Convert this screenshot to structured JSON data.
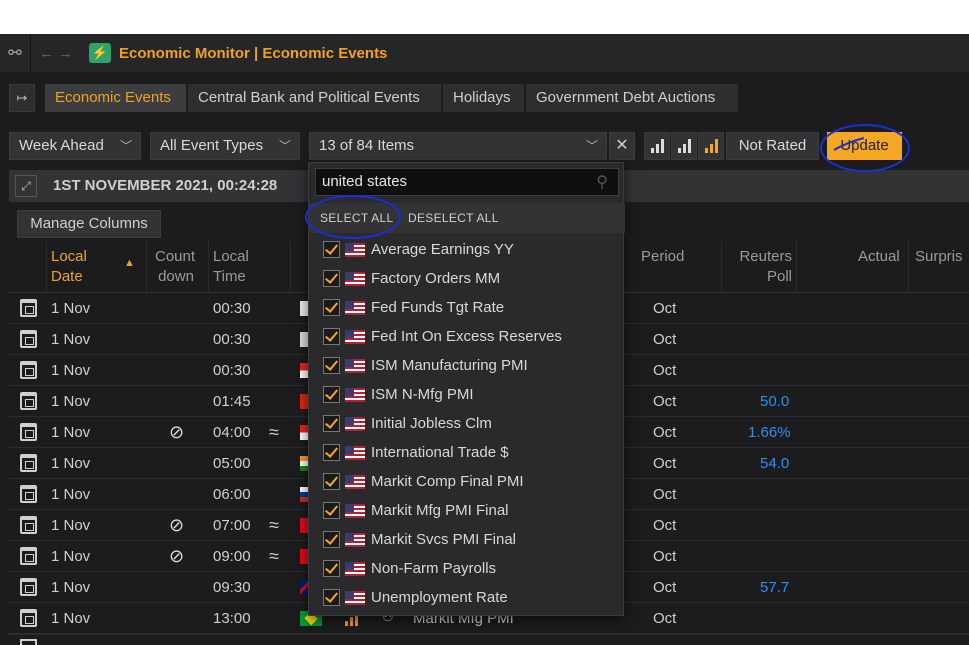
{
  "app": {
    "title": "Economic Monitor | Economic Events"
  },
  "tabs": [
    "Economic Events",
    "Central Bank and Political Events",
    "Holidays",
    "Government Debt Auctions"
  ],
  "filters": {
    "period": "Week Ahead",
    "event_types": "All Event Types",
    "items": "13 of 84 Items",
    "not_rated": "Not Rated",
    "update": "Update"
  },
  "date_header": "1ST NOVEMBER 2021, 00:24:28",
  "manage_columns": "Manage Columns",
  "columns": {
    "local_date_1": "Local",
    "local_date_2": "Date",
    "countdown_1": "Count",
    "countdown_2": "down",
    "local_time_1": "Local",
    "local_time_2": "Time",
    "period": "Period",
    "poll_1": "Reuters",
    "poll_2": "Poll",
    "actual": "Actual",
    "surprise": "Surpris"
  },
  "rows": [
    {
      "date": "1 Nov",
      "time": "00:30",
      "period": "Oct",
      "poll": ""
    },
    {
      "date": "1 Nov",
      "time": "00:30",
      "period": "Oct",
      "poll": ""
    },
    {
      "date": "1 Nov",
      "time": "00:30",
      "period": "Oct",
      "poll": ""
    },
    {
      "date": "1 Nov",
      "time": "01:45",
      "period": "Oct",
      "poll": "50.0"
    },
    {
      "date": "1 Nov",
      "time": "04:00",
      "period": "Oct",
      "poll": "1.66%"
    },
    {
      "date": "1 Nov",
      "time": "05:00",
      "period": "Oct",
      "poll": "54.0"
    },
    {
      "date": "1 Nov",
      "time": "06:00",
      "period": "Oct",
      "poll": ""
    },
    {
      "date": "1 Nov",
      "time": "07:00",
      "period": "Oct",
      "poll": ""
    },
    {
      "date": "1 Nov",
      "time": "09:00",
      "period": "Oct",
      "poll": ""
    },
    {
      "date": "1 Nov",
      "time": "09:30",
      "period": "Oct",
      "poll": "57.7"
    },
    {
      "date": "1 Nov",
      "time": "13:00",
      "period": "Oct",
      "poll": "",
      "event": "Markit Mfg PMI"
    }
  ],
  "dropdown": {
    "search": "united states",
    "select_all": "SELECT ALL",
    "deselect_all": "DESELECT ALL",
    "items": [
      "Average Earnings YY",
      "Factory Orders MM",
      "Fed Funds Tgt Rate",
      "Fed Int On Excess Reserves",
      "ISM Manufacturing PMI",
      "ISM N-Mfg PMI",
      "Initial Jobless Clm",
      "International Trade $",
      "Markit Comp Final PMI",
      "Markit Mfg PMI Final",
      "Markit Svcs PMI Final",
      "Non-Farm Payrolls",
      "Unemployment Rate"
    ]
  },
  "colors": {
    "accent": "#f0a21c",
    "update_bg": "#f5a623",
    "poll_blue": "#2f8ff0",
    "annotation": "#1a2fd6"
  }
}
